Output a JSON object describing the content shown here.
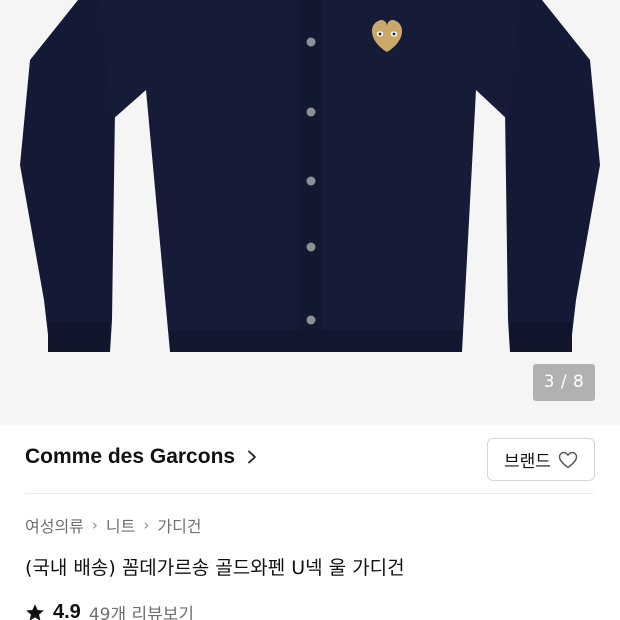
{
  "gallery": {
    "counter": "3 / 8",
    "current_index": 3,
    "total_images": 8,
    "image_alt": "Navy cardigan with gold heart patch"
  },
  "brand": {
    "name": "Comme des Garcons",
    "follow_button_label": "브랜드"
  },
  "breadcrumb": [
    "여성의류",
    "니트",
    "가디건"
  ],
  "product": {
    "title": "(국내 배송) 꼼데가르송 골드와펜 U넥 울 가디건",
    "rating": "4.9",
    "review_link": "49개 리뷰보기"
  },
  "colors": {
    "cardigan": "#141a35",
    "patch": "#c9a86a",
    "background": "#f5f5f5",
    "muted_text": "#6f6f6f"
  },
  "icons": {
    "brand_chevron": "chevron-right-icon",
    "brand_follow": "heart-outline-icon",
    "rating_star": "star-icon"
  }
}
